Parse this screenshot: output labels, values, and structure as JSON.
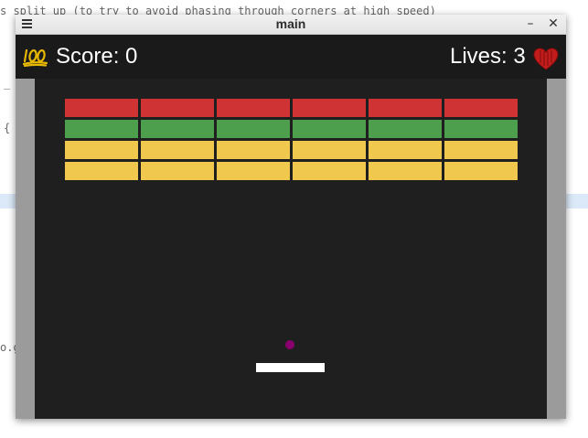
{
  "editor": {
    "lines": [
      "s split up (to try to avoid phasing through corners at high speed)",
      "_",
      "{",
      "o.g"
    ]
  },
  "window": {
    "title": "main",
    "minimize_label": "–",
    "close_label": "✕"
  },
  "hud": {
    "score_text": "Score: 0",
    "lives_text": "Lives: 3",
    "score_icon": "hundred-points-icon",
    "lives_icon": "heart-icon"
  },
  "game": {
    "brick_rows": [
      {
        "color": "#cf3333",
        "count": 6
      },
      {
        "color": "#4d9e4d",
        "count": 6
      },
      {
        "color": "#f1c84e",
        "count": 6
      },
      {
        "color": "#f1c84e",
        "count": 6
      }
    ],
    "ball_color": "#8a006e",
    "paddle_color": "#ffffff"
  }
}
